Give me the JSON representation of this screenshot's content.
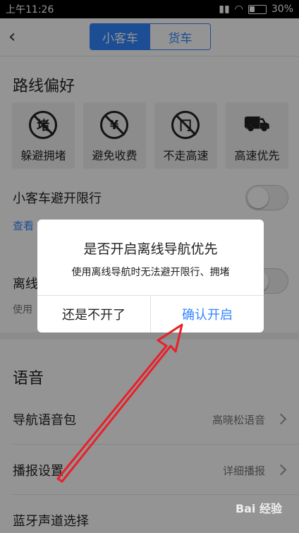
{
  "statusbar": {
    "time": "上午11:26",
    "battery": "30%"
  },
  "header": {
    "back_icon": "chevron-left-icon",
    "tabs": [
      {
        "label": "小客车"
      },
      {
        "label": "货车"
      }
    ]
  },
  "route_pref": {
    "title": "路线偏好",
    "options": [
      {
        "icon_char": "堵",
        "label": "躲避拥堵"
      },
      {
        "icon_char": "¥",
        "label": "避免收费"
      },
      {
        "icon_char": "冂",
        "label": "不走高速"
      },
      {
        "icon_char": "⛟",
        "label": "高速优先"
      }
    ]
  },
  "restriction": {
    "label": "小客车避开限行",
    "link": "查看"
  },
  "offline": {
    "label": "离线",
    "sub": "使用"
  },
  "voice": {
    "title": "语音",
    "items": [
      {
        "label": "导航语音包",
        "value": "高晓松语音"
      },
      {
        "label": "播报设置",
        "value": "详细播报"
      },
      {
        "label": "蓝牙声道选择"
      }
    ]
  },
  "dialog": {
    "title": "是否开启离线导航优先",
    "message": "使用离线导航时无法避开限行、拥堵",
    "cancel": "还是不开了",
    "confirm": "确认开启"
  },
  "watermark": "Bai 经验",
  "colors": {
    "accent": "#3385ff",
    "arrow": "#e8202a"
  }
}
